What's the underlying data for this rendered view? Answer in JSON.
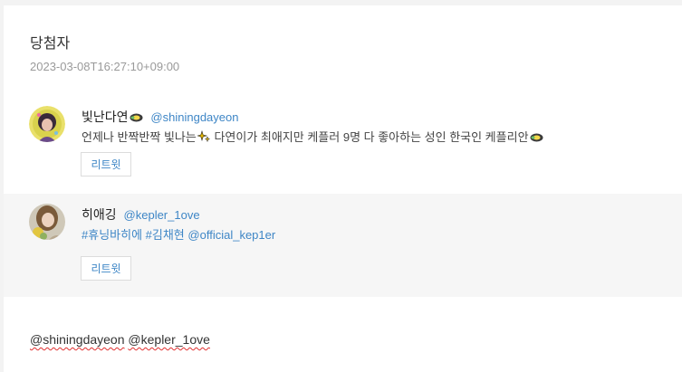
{
  "title": "당첨자",
  "timestamp": "2023-03-08T16:27:10+09:00",
  "entries": [
    {
      "name": "빛난다연",
      "handle": "@shiningdayeon",
      "text_a": "언제나 반짝반짝 빛나는",
      "text_b": " 다연이가 최애지만 케플러 9명 다 좋아하는 성인 한국인 케플리안",
      "retweet_label": "리트윗",
      "name_icon": "sparkle-emoji",
      "text_icons": [
        "sparkles-emoji",
        "sparkle-emoji"
      ]
    },
    {
      "name": "히애깅",
      "handle": "@kepler_1ove",
      "hashtags": [
        "#휴닝바히에",
        "#김채현"
      ],
      "mention": "@official_kep1er",
      "retweet_label": "리트윗"
    }
  ],
  "footer": {
    "mention1": "@shiningdayeon",
    "mention2": "@kepler_1ove"
  },
  "colors": {
    "link": "#3e86c6",
    "highlight_bg": "#f6f6f6",
    "page_bg": "#f3f3f3"
  }
}
